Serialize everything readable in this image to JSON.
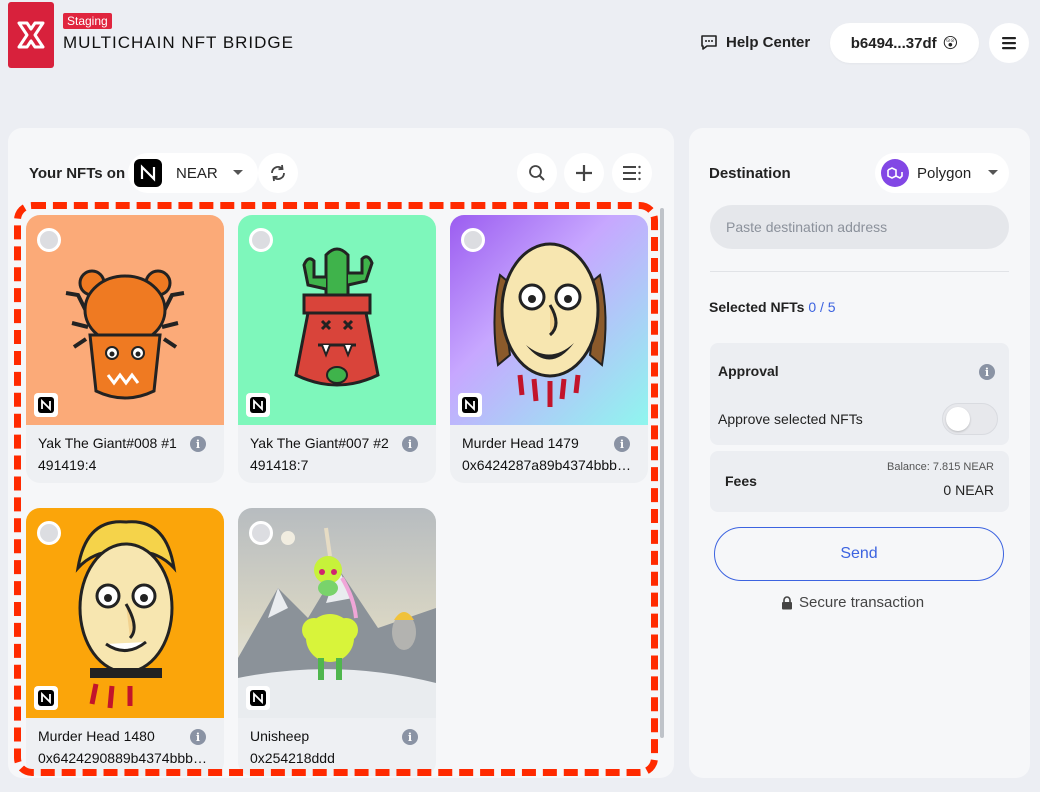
{
  "header": {
    "badge": "Staging",
    "title": "MULTICHAIN NFT BRIDGE",
    "help_label": "Help Center",
    "wallet_address": "b6494...37df",
    "wallet_emoji": "😲"
  },
  "left": {
    "your_nfts_label": "Your NFTs on",
    "chain": "NEAR"
  },
  "nfts": [
    {
      "name": "Yak The Giant#008 #1",
      "token": "491419:4",
      "bg": "#fbaa78"
    },
    {
      "name": "Yak The Giant#007 #2",
      "token": "491418:7",
      "bg": "#7ef7bb"
    },
    {
      "name": "Murder Head 1479",
      "token": "0x6424287a89b4374bbbbbbb",
      "bg": "#a670e8"
    },
    {
      "name": "Murder Head 1480",
      "token": "0x6424290889b4374bbbbbbb",
      "bg": "#fba50a"
    },
    {
      "name": "Unisheep",
      "token": "0x254218ddd",
      "bg": "#a7aeb5"
    }
  ],
  "right": {
    "destination_label": "Destination",
    "destination_chain": "Polygon",
    "address_placeholder": "Paste destination address",
    "selected_label": "Selected NFTs",
    "selected_count": "0 / 5",
    "approval_title": "Approval",
    "approve_label": "Approve selected NFTs",
    "fees_label": "Fees",
    "balance": "Balance: 7.815 NEAR",
    "fee_value": "0 NEAR",
    "send_label": "Send",
    "secure_label": "Secure transaction"
  }
}
